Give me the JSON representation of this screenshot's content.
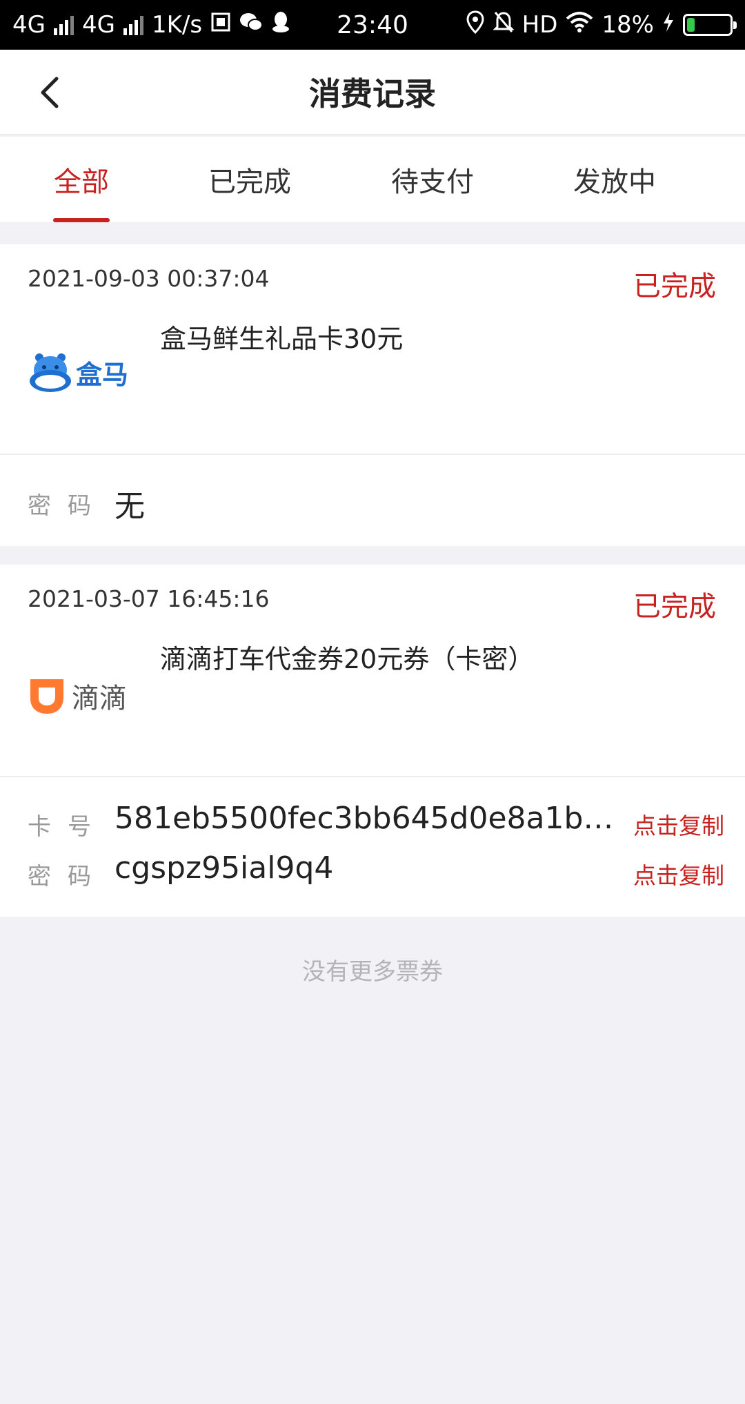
{
  "status_bar": {
    "net1": "4G",
    "net2": "4G",
    "speed": "1K/s",
    "time": "23:40",
    "hd": "HD",
    "battery_pct": "18%",
    "battery_level": 0.18
  },
  "header": {
    "title": "消费记录"
  },
  "tabs": [
    {
      "label": "全部",
      "active": true
    },
    {
      "label": "已完成",
      "active": false
    },
    {
      "label": "待支付",
      "active": false
    },
    {
      "label": "发放中",
      "active": false
    }
  ],
  "orders": [
    {
      "date": "2021-09-03 00:37:04",
      "status": "已完成",
      "product": "盒马鲜生礼品卡30元",
      "logo_text": "盒马",
      "password_label": "密码",
      "password": "无"
    },
    {
      "date": "2021-03-07 16:45:16",
      "status": "已完成",
      "product": "滴滴打车代金券20元券（卡密）",
      "logo_text": "滴滴",
      "card_label": "卡号",
      "card_number": "581eb5500fec3bb645d0e8a1b5…",
      "password_label": "密码",
      "password": "cgspz95ial9q4",
      "copy_label": "点击复制"
    }
  ],
  "footer": {
    "no_more": "没有更多票券"
  },
  "colors": {
    "accent": "#c8211f",
    "hema_blue": "#1e6fd0",
    "didi_orange": "#ff7a30"
  }
}
